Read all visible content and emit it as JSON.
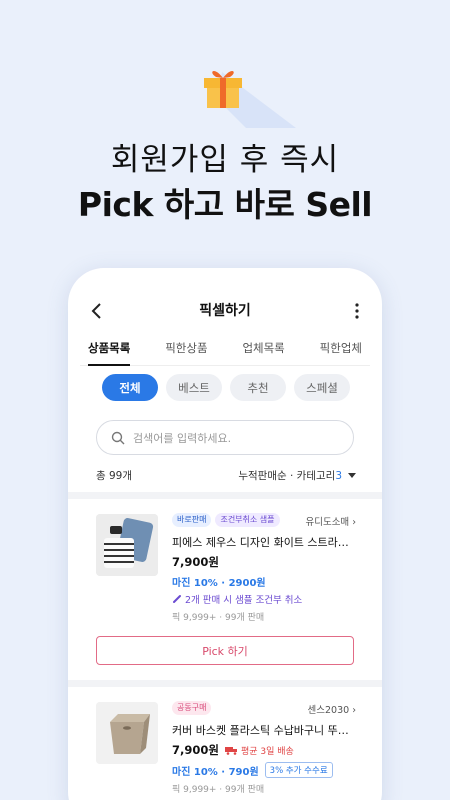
{
  "hero": {
    "line1": "회원가입 후 즉시",
    "line2": "Pick 하고 바로 Sell",
    "icon": "gift-box-icon"
  },
  "app": {
    "title": "픽셀하기",
    "tabs": [
      "상품목록",
      "픽한상품",
      "업체목록",
      "픽한업체"
    ],
    "active_tab": "상품목록",
    "chips": [
      "전체",
      "베스트",
      "추천",
      "스페셜"
    ],
    "active_chip": "전체",
    "search": {
      "placeholder": "검색어를 입력하세요."
    },
    "summary": {
      "total": "총 99개",
      "sort": "누적판매순 · 카테고리",
      "category_count": "3"
    },
    "products": [
      {
        "badges": [
          "바로판매",
          "조건부취소 샘플"
        ],
        "seller": "유디도소매",
        "name": "피에스 제우스 디자인 화이트 스트라이…",
        "price": "7,900원",
        "margin": "마진 10% · 2900원",
        "promo": "2개 판매 시 샘플 조건부 취소",
        "stats": "픽 9,999+ · 99개 판매",
        "button": "Pick 하기"
      },
      {
        "badges": [
          "공동구매"
        ],
        "seller": "센스2030",
        "name": "커버 바스켓 플라스틱 수납바구니 뚜껑…",
        "price": "7,900원",
        "delivery": "평균 3일 배송",
        "margin": "마진 10% · 790원",
        "fee": "3% 추가 수수료",
        "stats": "픽 9,999+ · 99개 판매"
      }
    ]
  },
  "colors": {
    "background": "#eaf0fb",
    "accent": "#2a79e6",
    "pick": "#d8496b",
    "gift": "#f6b534"
  }
}
